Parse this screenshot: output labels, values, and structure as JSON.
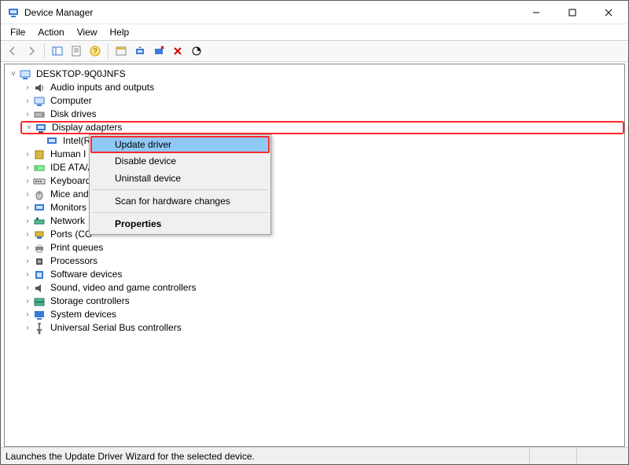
{
  "window": {
    "title": "Device Manager"
  },
  "menu": {
    "file": "File",
    "action": "Action",
    "view": "View",
    "help": "Help"
  },
  "root": {
    "label": "DESKTOP-9Q0JNFS"
  },
  "categories": [
    {
      "label": "Audio inputs and outputs",
      "expanded": false
    },
    {
      "label": "Computer",
      "expanded": false
    },
    {
      "label": "Disk drives",
      "expanded": false
    },
    {
      "label": "Display adapters",
      "expanded": true,
      "highlighted": true
    },
    {
      "label": "Human Interface Devices",
      "expanded": false,
      "truncated": "Human I"
    },
    {
      "label": "IDE ATA/ATAPI controllers",
      "expanded": false,
      "truncated": "IDE ATA/A"
    },
    {
      "label": "Keyboards",
      "expanded": false,
      "truncated": "Keyboard"
    },
    {
      "label": "Mice and other pointing devices",
      "expanded": false,
      "truncated": "Mice and"
    },
    {
      "label": "Monitors",
      "expanded": false,
      "truncated": "Monitors"
    },
    {
      "label": "Network adapters",
      "expanded": false,
      "truncated": "Network"
    },
    {
      "label": "Ports (COM & LPT)",
      "expanded": false,
      "truncated": "Ports (CO"
    },
    {
      "label": "Print queues",
      "expanded": false
    },
    {
      "label": "Processors",
      "expanded": false
    },
    {
      "label": "Software devices",
      "expanded": false
    },
    {
      "label": "Sound, video and game controllers",
      "expanded": false
    },
    {
      "label": "Storage controllers",
      "expanded": false
    },
    {
      "label": "System devices",
      "expanded": false
    },
    {
      "label": "Universal Serial Bus controllers",
      "expanded": false
    }
  ],
  "display_child": {
    "label_visible": "Intel(R"
  },
  "context_menu": {
    "update": "Update driver",
    "disable": "Disable device",
    "uninstall": "Uninstall device",
    "scan": "Scan for hardware changes",
    "properties": "Properties",
    "selected": "update"
  },
  "status": {
    "text": "Launches the Update Driver Wizard for the selected device."
  }
}
